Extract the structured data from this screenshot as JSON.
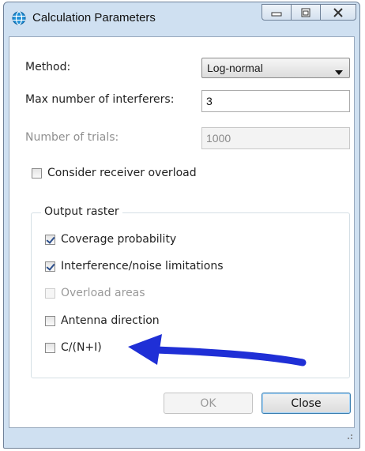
{
  "window": {
    "title": "Calculation Parameters",
    "icon": "globe-icon",
    "caption_buttons": [
      "minimize-icon",
      "restore-icon",
      "close-icon"
    ]
  },
  "form": {
    "method_label": "Method:",
    "method_value": "Log-normal",
    "max_interferers_label": "Max number of interferers:",
    "max_interferers_value": "3",
    "num_trials_label": "Number of trials:",
    "num_trials_value": "1000",
    "consider_overload_label": "Consider receiver overload",
    "consider_overload_checked": false
  },
  "output_raster": {
    "title": "Output raster",
    "items": [
      {
        "label": "Coverage probability",
        "checked": true,
        "enabled": true
      },
      {
        "label": "Interference/noise limitations",
        "checked": true,
        "enabled": true
      },
      {
        "label": "Overload areas",
        "checked": false,
        "enabled": false
      },
      {
        "label": "Antenna direction",
        "checked": false,
        "enabled": true
      },
      {
        "label": "C/(N+I)",
        "checked": false,
        "enabled": true
      }
    ]
  },
  "buttons": {
    "ok_label": "OK",
    "close_label": "Close"
  },
  "annotation": {
    "arrow_color": "#1f2fd6"
  }
}
